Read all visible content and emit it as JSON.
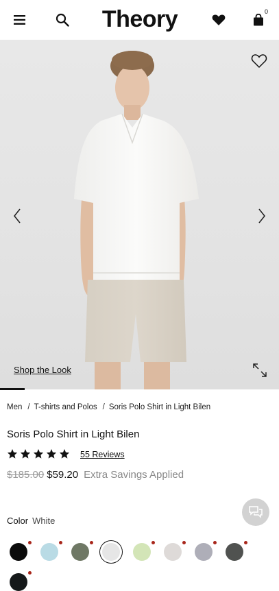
{
  "header": {
    "brand": "Theory",
    "bag_count": "0",
    "icons": [
      "menu-icon",
      "search-icon",
      "heart-icon",
      "shopping-bag-icon"
    ]
  },
  "hero": {
    "shop_the_look": "Shop the Look",
    "icons": [
      "wishlist-heart-icon",
      "chevron-left-icon",
      "chevron-right-icon",
      "expand-icon"
    ]
  },
  "breadcrumb": {
    "items": [
      "Men",
      "T-shirts and Polos",
      "Soris Polo Shirt in Light Bilen"
    ]
  },
  "product": {
    "title": "Soris Polo Shirt in Light Bilen",
    "rating": 5,
    "reviews_label": "55 Reviews",
    "original_price": "$185.00",
    "sale_price": "$59.20",
    "savings_label": "Extra Savings Applied"
  },
  "color": {
    "label": "Color",
    "selected": "White",
    "swatches": [
      {
        "color": "#0b0b0b",
        "selected": false
      },
      {
        "color": "#b9dbe5",
        "selected": false
      },
      {
        "color": "#6f7865",
        "selected": false
      },
      {
        "color": "#e6e6e6",
        "selected": true
      },
      {
        "color": "#d3e5b7",
        "selected": false
      },
      {
        "color": "#dedad8",
        "selected": false
      },
      {
        "color": "#aeaeb8",
        "selected": false
      },
      {
        "color": "#505250",
        "selected": false
      },
      {
        "color": "#15191a",
        "selected": false
      }
    ]
  },
  "colors": {
    "accent_dot": "#a8261b",
    "chat_button": "#d2d2d2"
  }
}
